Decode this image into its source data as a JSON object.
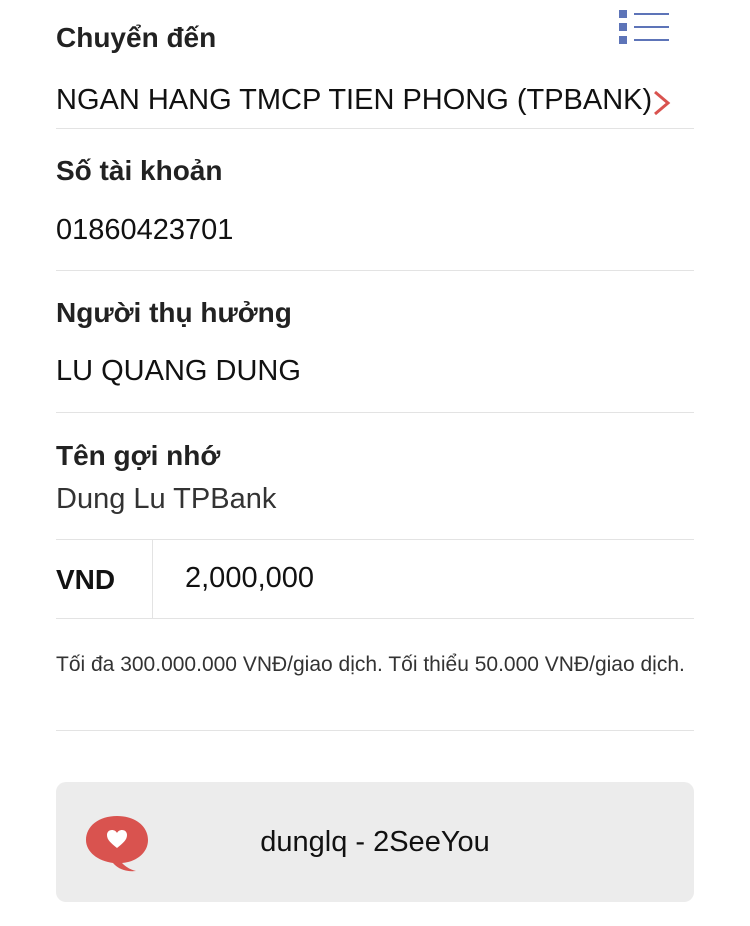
{
  "destination": {
    "label": "Chuyển đến",
    "bank_name": "NGAN HANG TMCP TIEN PHONG (TPBANK)"
  },
  "account": {
    "label": "Số tài khoản",
    "number": "01860423701"
  },
  "beneficiary": {
    "label": "Người thụ hưởng",
    "name": "LU QUANG DUNG"
  },
  "nickname": {
    "label": "Tên gợi nhớ",
    "value": "Dung Lu TPBank"
  },
  "amount": {
    "currency": "VND",
    "value": "2,000,000"
  },
  "limit_note": "Tối đa 300.000.000 VNĐ/giao dịch. Tối thiểu 50.000 VNĐ/giao dịch.",
  "memo": {
    "text": "dunglq - 2SeeYou"
  },
  "colors": {
    "accent_red": "#d9534f",
    "icon_blue": "#5d74b8",
    "memo_bg": "#ececec"
  },
  "icons": [
    "list-menu-icon",
    "chevron-right-icon",
    "heart-chat-icon"
  ]
}
